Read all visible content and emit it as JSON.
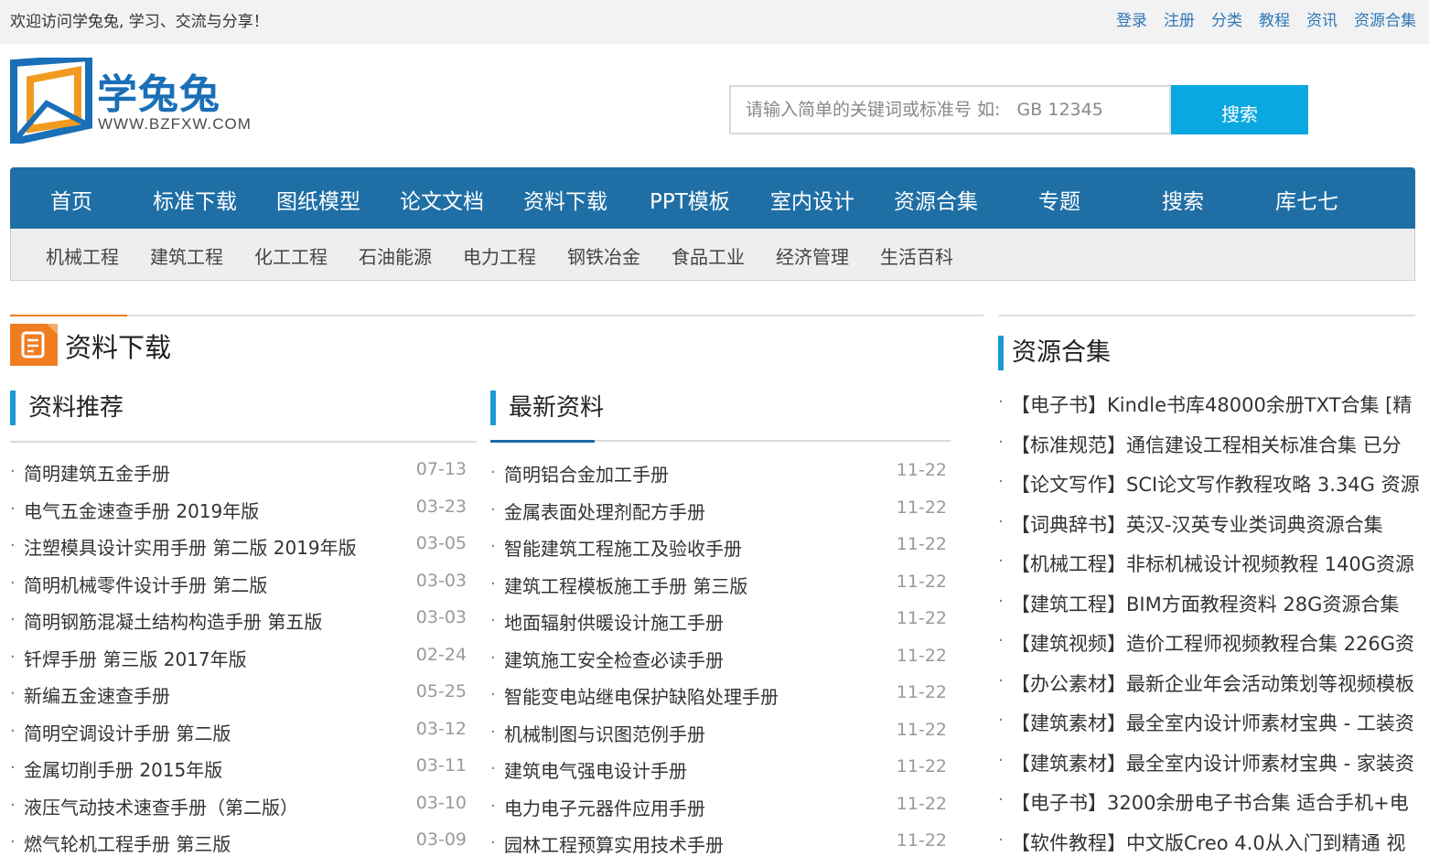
{
  "topbar": {
    "welcome": "欢迎访问学兔兔, 学习、交流与分享！",
    "links": [
      "登录",
      "注册",
      "分类",
      "教程",
      "资讯",
      "资源合集"
    ]
  },
  "logo": {
    "name": "学兔兔",
    "url": "WWW.BZFXW.COM"
  },
  "search": {
    "placeholder": "请输入简单的关键词或标准号 如:   GB 12345",
    "button": "搜索"
  },
  "main_nav": [
    "首页",
    "标准下载",
    "图纸模型",
    "论文文档",
    "资料下载",
    "PPT模板",
    "室内设计",
    "资源合集",
    "专题",
    "搜索",
    "库七七"
  ],
  "sub_nav": [
    "机械工程",
    "建筑工程",
    "化工工程",
    "石油能源",
    "电力工程",
    "钢铁冶金",
    "食品工业",
    "经济管理",
    "生活百科"
  ],
  "section": {
    "title": "资料下载"
  },
  "recommend": {
    "title": "资料推荐",
    "items": [
      {
        "title": "简明建筑五金手册",
        "date": "07-13"
      },
      {
        "title": "电气五金速查手册 2019年版",
        "date": "03-23"
      },
      {
        "title": "注塑模具设计实用手册 第二版 2019年版",
        "date": "03-05"
      },
      {
        "title": "简明机械零件设计手册 第二版",
        "date": "03-03"
      },
      {
        "title": "简明钢筋混凝土结构构造手册 第五版",
        "date": "03-03"
      },
      {
        "title": "钎焊手册 第三版 2017年版",
        "date": "02-24"
      },
      {
        "title": "新编五金速查手册",
        "date": "05-25"
      },
      {
        "title": "简明空调设计手册 第二版",
        "date": "03-12"
      },
      {
        "title": "金属切削手册 2015年版",
        "date": "03-11"
      },
      {
        "title": "液压气动技术速查手册（第二版）",
        "date": "03-10"
      },
      {
        "title": "燃气轮机工程手册 第三版",
        "date": "03-09"
      }
    ]
  },
  "latest": {
    "title": "最新资料",
    "items": [
      {
        "title": "简明铝合金加工手册",
        "date": "11-22"
      },
      {
        "title": "金属表面处理剂配方手册",
        "date": "11-22"
      },
      {
        "title": "智能建筑工程施工及验收手册",
        "date": "11-22"
      },
      {
        "title": "建筑工程模板施工手册 第三版",
        "date": "11-22"
      },
      {
        "title": "地面辐射供暖设计施工手册",
        "date": "11-22"
      },
      {
        "title": "建筑施工安全检查必读手册",
        "date": "11-22"
      },
      {
        "title": "智能变电站继电保护缺陷处理手册",
        "date": "11-22"
      },
      {
        "title": "机械制图与识图范例手册",
        "date": "11-22"
      },
      {
        "title": "建筑电气强电设计手册",
        "date": "11-22"
      },
      {
        "title": "电力电子元器件应用手册",
        "date": "11-22"
      },
      {
        "title": "园林工程预算实用技术手册",
        "date": "11-22"
      }
    ]
  },
  "resources": {
    "title": "资源合集",
    "items": [
      "【电子书】Kindle书库48000余册TXT合集 [精",
      "【标准规范】通信建设工程相关标准合集 已分",
      "【论文写作】SCI论文写作教程攻略 3.34G 资源",
      "【词典辞书】英汉-汉英专业类词典资源合集",
      "【机械工程】非标机械设计视频教程 140G资源",
      "【建筑工程】BIM方面教程资料 28G资源合集",
      "【建筑视频】造价工程师视频教程合集 226G资",
      "【办公素材】最新企业年会活动策划等视频模板",
      "【建筑素材】最全室内设计师素材宝典 - 工装资",
      "【建筑素材】最全室内设计师素材宝典 - 家装资",
      "【电子书】3200余册电子书合集 适合手机+电",
      "【软件教程】中文版Creo 4.0从入门到精通 视"
    ]
  },
  "colors": {
    "nav": "#1f6fa6",
    "accent_orange": "#f07d20",
    "accent_blue": "#1a9ad6",
    "search_button": "#0ba7e0",
    "link": "#2f77b9"
  }
}
